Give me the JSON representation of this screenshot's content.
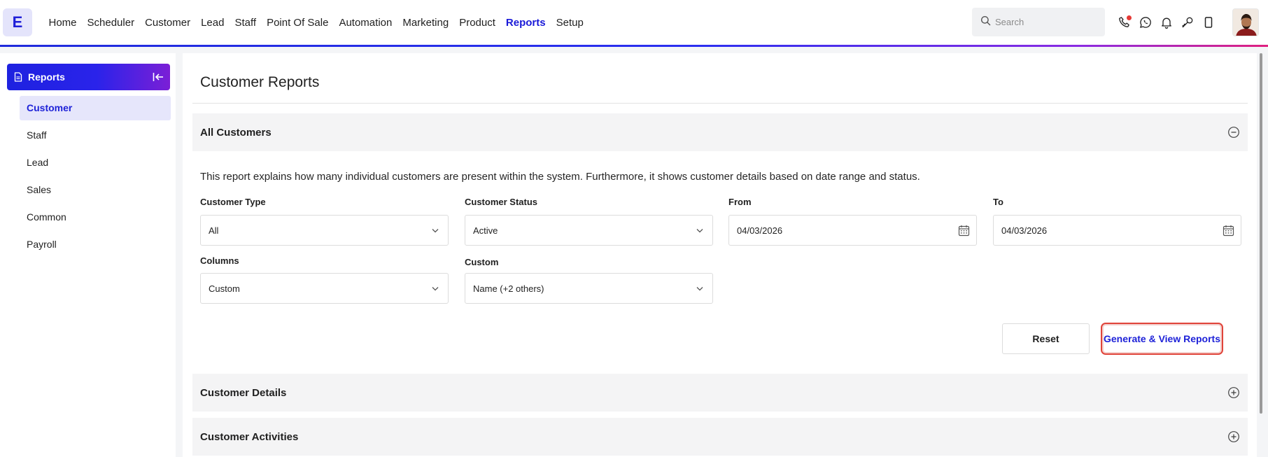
{
  "brand": {
    "logo_letter": "E"
  },
  "nav": {
    "items": [
      "Home",
      "Scheduler",
      "Customer",
      "Lead",
      "Staff",
      "Point Of Sale",
      "Automation",
      "Marketing",
      "Product",
      "Reports",
      "Setup"
    ],
    "active": "Reports"
  },
  "search": {
    "placeholder": "Search"
  },
  "top_icons": [
    "phone-icon",
    "whatsapp-icon",
    "bell-icon",
    "key-icon",
    "mobile-icon"
  ],
  "sidebar": {
    "title": "Reports",
    "items": [
      "Customer",
      "Staff",
      "Lead",
      "Sales",
      "Common",
      "Payroll"
    ],
    "active": "Customer"
  },
  "main": {
    "page_title": "Customer Reports",
    "sections": [
      {
        "label": "All Customers",
        "expanded": true
      },
      {
        "label": "Customer Details",
        "expanded": false
      },
      {
        "label": "Customer Activities",
        "expanded": false
      }
    ],
    "description": "This report explains how many individual customers are present within the system. Furthermore, it shows customer details based on date range and status.",
    "filters": {
      "customer_type": {
        "label": "Customer Type",
        "value": "All"
      },
      "customer_status": {
        "label": "Customer Status",
        "value": "Active"
      },
      "from": {
        "label": "From",
        "value": "04/03/2026"
      },
      "to": {
        "label": "To",
        "value": "04/03/2026"
      },
      "columns": {
        "label": "Columns",
        "value": "Custom"
      },
      "custom": {
        "label": "Custom",
        "value": "Name (+2 others)"
      }
    },
    "buttons": {
      "reset": "Reset",
      "generate": "Generate & View Reports"
    }
  },
  "colors": {
    "accent": "#1e22d8",
    "highlight_border": "#e0443a",
    "notification_dot": "#e53935"
  }
}
